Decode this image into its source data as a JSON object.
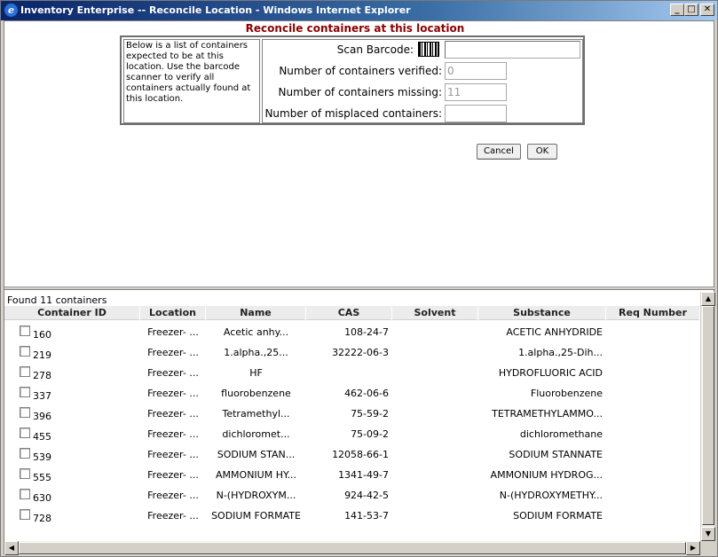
{
  "window": {
    "title": "Inventory Enterprise -- Reconcile Location - Windows Internet Explorer",
    "minimize": "_",
    "maximize": "□",
    "close": "✕"
  },
  "page": {
    "heading": "Reconcile containers at this location",
    "instructions": "Below is a list of containers expected to be at this location. Use the barcode scanner to verify all containers actually found at this location.",
    "scan_label": "Scan Barcode:",
    "scan_value": "",
    "verified_label": "Number of containers verified:",
    "verified_value": "0",
    "missing_label": "Number of containers missing:",
    "missing_value": "11",
    "misplaced_label": "Number of misplaced containers:",
    "misplaced_value": "",
    "cancel_label": "Cancel",
    "ok_label": "OK"
  },
  "results": {
    "found_text": "Found 11 containers",
    "columns": [
      "Container ID",
      "Location",
      "Name",
      "CAS",
      "Solvent",
      "Substance",
      "Req Number"
    ],
    "rows": [
      {
        "id": "160",
        "location": "Freezer- ...",
        "name": "Acetic anhy...",
        "cas": "108-24-7",
        "solvent": "",
        "substance": "ACETIC ANHYDRIDE"
      },
      {
        "id": "219",
        "location": "Freezer- ...",
        "name": "1.alpha.,25...",
        "cas": "32222-06-3",
        "solvent": "",
        "substance": "1.alpha.,25-Dih..."
      },
      {
        "id": "278",
        "location": "Freezer- ...",
        "name": "HF",
        "cas": "",
        "solvent": "",
        "substance": "HYDROFLUORIC ACID"
      },
      {
        "id": "337",
        "location": "Freezer- ...",
        "name": "fluorobenzene",
        "cas": "462-06-6",
        "solvent": "",
        "substance": "Fluorobenzene"
      },
      {
        "id": "396",
        "location": "Freezer- ...",
        "name": "Tetramethyl...",
        "cas": "75-59-2",
        "solvent": "",
        "substance": "TETRAMETHYLAMMO..."
      },
      {
        "id": "455",
        "location": "Freezer- ...",
        "name": "dichloromet...",
        "cas": "75-09-2",
        "solvent": "",
        "substance": "dichloromethane"
      },
      {
        "id": "539",
        "location": "Freezer- ...",
        "name": "SODIUM STAN...",
        "cas": "12058-66-1",
        "solvent": "",
        "substance": "SODIUM STANNATE"
      },
      {
        "id": "555",
        "location": "Freezer- ...",
        "name": "AMMONIUM HY...",
        "cas": "1341-49-7",
        "solvent": "",
        "substance": "AMMONIUM HYDROG..."
      },
      {
        "id": "630",
        "location": "Freezer- ...",
        "name": "N-(HYDROXYM...",
        "cas": "924-42-5",
        "solvent": "",
        "substance": "N-(HYDROXYMETHY..."
      },
      {
        "id": "728",
        "location": "Freezer- ...",
        "name": "SODIUM FORMATE",
        "cas": "141-53-7",
        "solvent": "",
        "substance": "SODIUM FORMATE"
      }
    ]
  },
  "scroll": {
    "up": "▲",
    "down": "▼",
    "left": "◀",
    "right": "▶"
  }
}
